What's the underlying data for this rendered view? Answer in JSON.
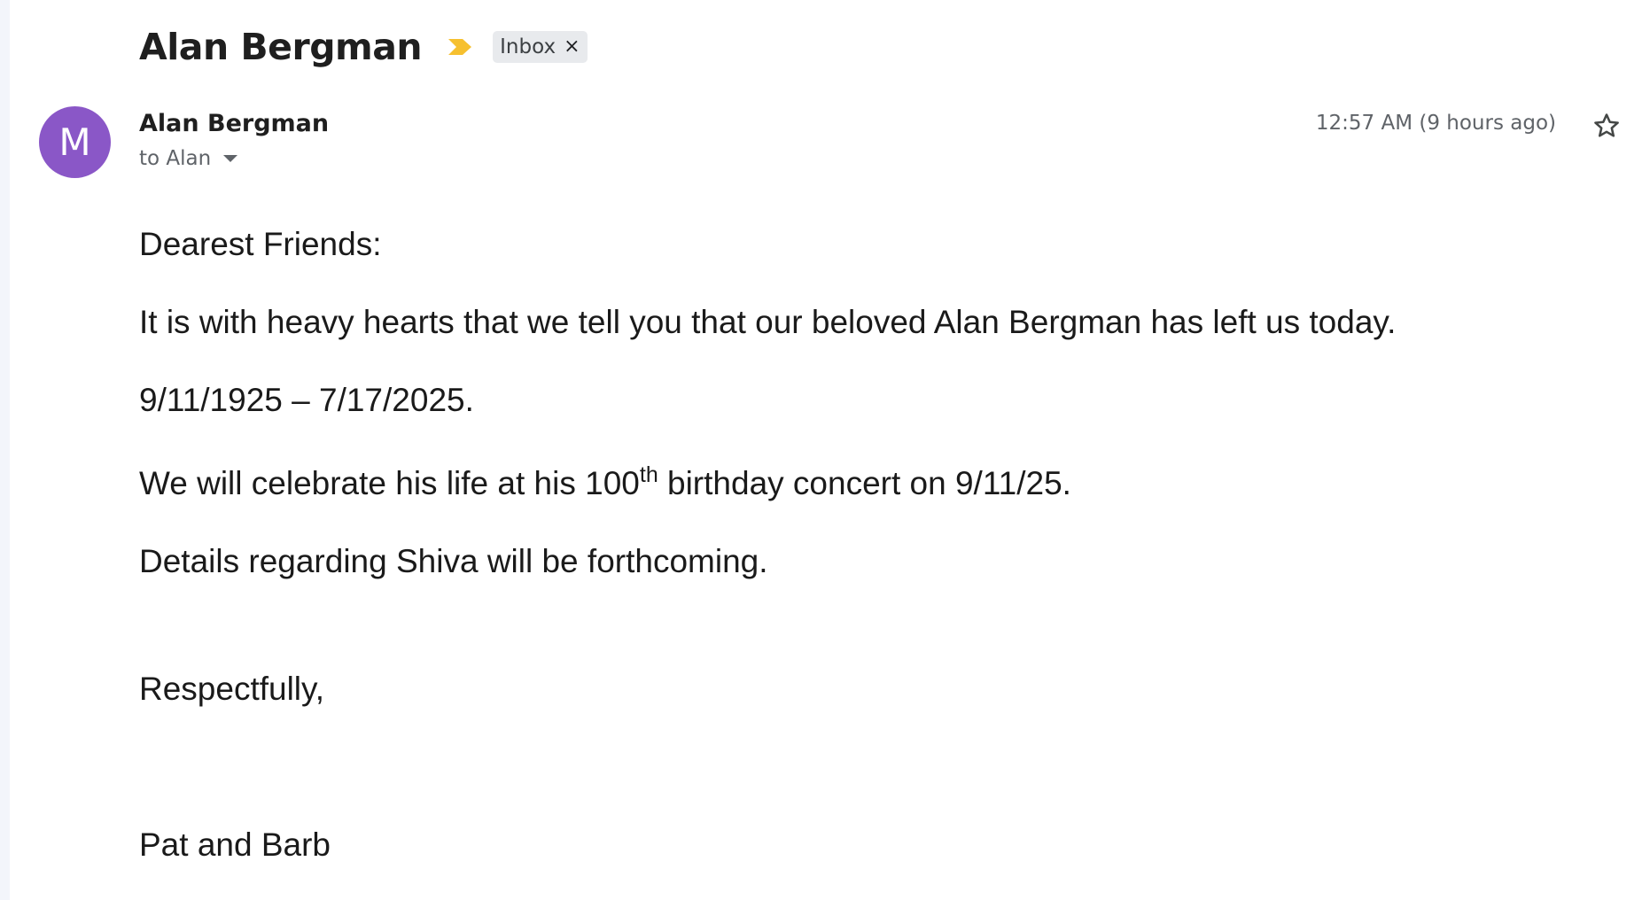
{
  "email": {
    "subject": "Alan Bergman",
    "label_chip": "Inbox",
    "label_remove": "×",
    "sender": {
      "avatar_letter": "M",
      "avatar_color": "#8a57c7",
      "name": "Alan Bergman",
      "recipient": "to Alan"
    },
    "timestamp": "12:57 AM (9 hours ago)",
    "importance_color": "#f6c02f",
    "body": {
      "greeting": "Dearest Friends:",
      "paragraph1": "It is with heavy hearts that we tell you that our beloved Alan Bergman has left us today.",
      "dates": "9/11/1925 – 7/17/2025.",
      "paragraph3_before": "We will celebrate his life at his 100",
      "paragraph3_sup": "th",
      "paragraph3_after": " birthday concert on 9/11/25.",
      "paragraph4": "Details regarding Shiva will be forthcoming.",
      "closing": "Respectfully,",
      "signature": "Pat and Barb"
    }
  }
}
